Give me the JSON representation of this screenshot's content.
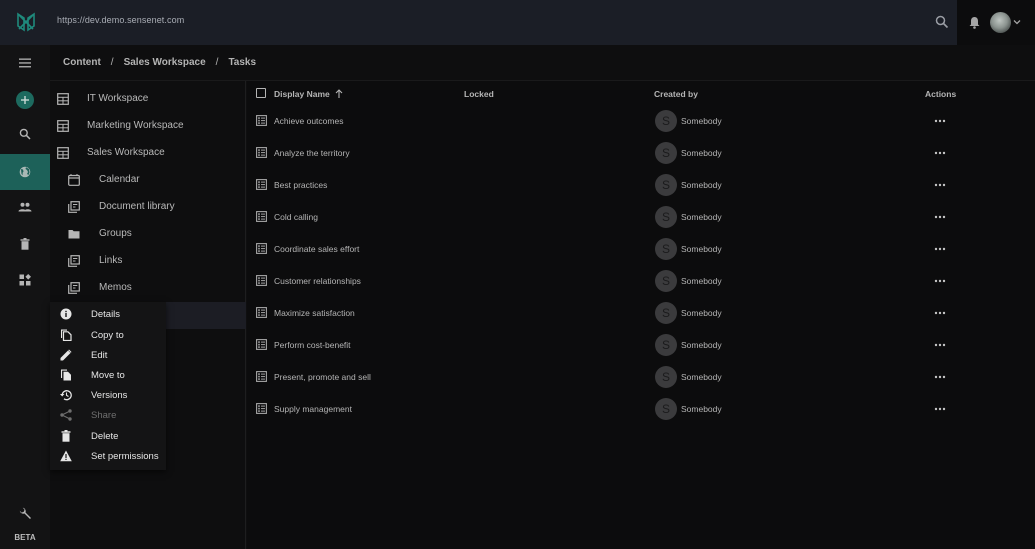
{
  "header": {
    "url": "https://dev.demo.sensenet.com",
    "brand_color": "#1d6159"
  },
  "rail": {
    "items": [
      {
        "name": "menu",
        "icon": "hamburger-icon"
      },
      {
        "name": "add",
        "icon": "plus-icon"
      },
      {
        "name": "search",
        "icon": "search-icon"
      },
      {
        "name": "content",
        "icon": "globe-icon",
        "active": true
      },
      {
        "name": "users-and-groups",
        "icon": "people-icon"
      },
      {
        "name": "trash",
        "icon": "trash-icon"
      },
      {
        "name": "content-types",
        "icon": "widgets-icon"
      },
      {
        "name": "setup",
        "icon": "wrench-icon"
      }
    ],
    "beta_label": "BETA"
  },
  "breadcrumb": {
    "items": [
      "Content",
      "Sales Workspace",
      "Tasks"
    ],
    "separator": "/"
  },
  "tree": {
    "items": [
      {
        "label": "IT Workspace",
        "icon": "workspace-icon",
        "level": 0
      },
      {
        "label": "Marketing Workspace",
        "icon": "workspace-icon",
        "level": 0
      },
      {
        "label": "Sales Workspace",
        "icon": "workspace-icon",
        "level": 0
      },
      {
        "label": "Calendar",
        "icon": "calendar-icon",
        "level": 1
      },
      {
        "label": "Document library",
        "icon": "library-icon",
        "level": 1
      },
      {
        "label": "Groups",
        "icon": "folder-icon",
        "level": 1
      },
      {
        "label": "Links",
        "icon": "library-icon",
        "level": 1
      },
      {
        "label": "Memos",
        "icon": "library-icon",
        "level": 1
      }
    ]
  },
  "context_menu": {
    "items": [
      {
        "label": "Details",
        "icon": "info-icon",
        "disabled": false
      },
      {
        "label": "Copy to",
        "icon": "copy-icon",
        "disabled": false
      },
      {
        "label": "Edit",
        "icon": "pencil-icon",
        "disabled": false
      },
      {
        "label": "Move to",
        "icon": "move-icon",
        "disabled": false
      },
      {
        "label": "Versions",
        "icon": "history-icon",
        "disabled": false
      },
      {
        "label": "Share",
        "icon": "share-icon",
        "disabled": true
      },
      {
        "label": "Delete",
        "icon": "trash-icon",
        "disabled": false
      },
      {
        "label": "Set permissions",
        "icon": "warning-icon",
        "disabled": false
      }
    ]
  },
  "table": {
    "columns": {
      "display_name": "Display Name",
      "locked": "Locked",
      "created_by": "Created by",
      "actions": "Actions"
    },
    "sort": {
      "column": "Display Name",
      "direction": "ascending"
    },
    "rows": [
      {
        "name": "Achieve outcomes",
        "created_by": "Somebody",
        "avatar_letter": "S"
      },
      {
        "name": "Analyze the territory",
        "created_by": "Somebody",
        "avatar_letter": "S"
      },
      {
        "name": "Best practices",
        "created_by": "Somebody",
        "avatar_letter": "S"
      },
      {
        "name": "Cold calling",
        "created_by": "Somebody",
        "avatar_letter": "S"
      },
      {
        "name": "Coordinate sales effort",
        "created_by": "Somebody",
        "avatar_letter": "S"
      },
      {
        "name": "Customer relationships",
        "created_by": "Somebody",
        "avatar_letter": "S"
      },
      {
        "name": "Maximize satisfaction",
        "created_by": "Somebody",
        "avatar_letter": "S"
      },
      {
        "name": "Perform cost-benefit",
        "created_by": "Somebody",
        "avatar_letter": "S"
      },
      {
        "name": "Present, promote and sell",
        "created_by": "Somebody",
        "avatar_letter": "S"
      },
      {
        "name": "Supply management",
        "created_by": "Somebody",
        "avatar_letter": "S"
      }
    ]
  }
}
